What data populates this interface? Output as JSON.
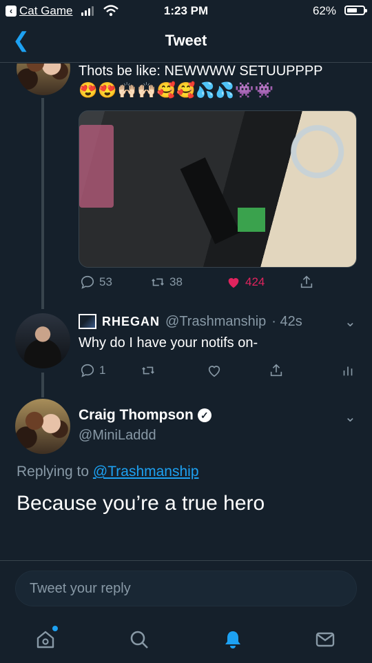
{
  "status_bar": {
    "back_app": "Cat Game",
    "time": "1:23 PM",
    "battery_pct": "62%",
    "battery_level": 0.62
  },
  "header": {
    "title": "Tweet"
  },
  "parent_tweet": {
    "text": "Thots be like: NEWWWW SETUUPPPP",
    "emojis": "😍😍🙌🏻🙌🏻🥰🥰💦💦👾👾",
    "stats": {
      "replies": "53",
      "retweets": "38",
      "likes": "424"
    },
    "like_color": "#e0245e"
  },
  "reply_tweet": {
    "display_name": "RHEGAN",
    "handle": "@Trashmanship",
    "time": "· 42s",
    "text": "Why do I have your notifs on-",
    "replies": "1"
  },
  "main_tweet": {
    "display_name": "Craig Thompson",
    "handle": "@MiniLaddd",
    "replying_prefix": "Replying to",
    "replying_handle": "@Trashmanship",
    "text": "Because you’re a true hero"
  },
  "compose": {
    "placeholder": "Tweet your reply"
  },
  "tabbar": {
    "icons": [
      "home-icon",
      "search-icon",
      "notifications-icon",
      "messages-icon"
    ],
    "active": "notifications-icon",
    "accent": "#1da1f2"
  }
}
